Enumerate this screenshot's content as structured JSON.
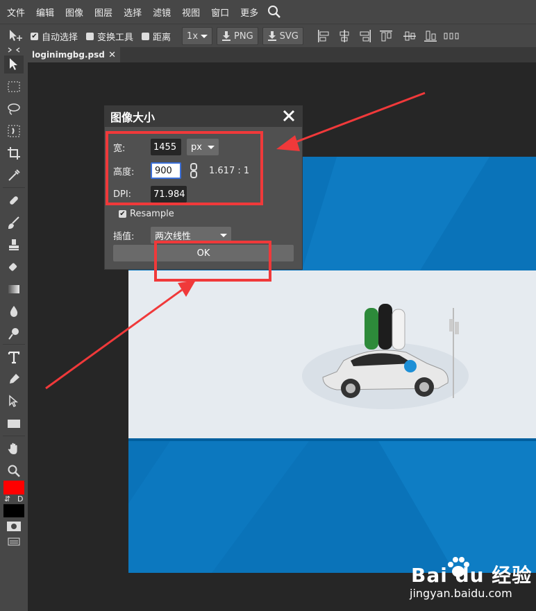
{
  "menu": {
    "items": [
      "文件",
      "编辑",
      "图像",
      "图层",
      "选择",
      "滤镜",
      "视图",
      "窗口",
      "更多"
    ],
    "search_icon": "search-icon"
  },
  "options": {
    "auto_select": "自动选择",
    "transform_tools": "变换工具",
    "distance": "距离",
    "zoom": "1x",
    "png": "PNG",
    "svg": "SVG"
  },
  "document": {
    "tab_name": "loginimgbg.psd",
    "close": "✕"
  },
  "dialog": {
    "title": "图像大小",
    "width_label": "宽:",
    "width_value": "1455",
    "unit": "px",
    "height_label": "高度:",
    "height_value": "900",
    "ratio": "1.617 : 1",
    "dpi_label": "DPI:",
    "dpi_value": "71.984",
    "resample_label": "Resample",
    "interp_label": "插值:",
    "interp_value": "两次线性",
    "ok_label": "OK"
  },
  "colors": {
    "foreground": "#ff0000",
    "background": "#000000",
    "highlight": "#f0393a",
    "canvas_blue": "#0a73b9"
  },
  "swatches": {
    "swap": "⇵",
    "default": "D"
  },
  "watermark": {
    "brand": "Bai du 经验",
    "url": "jingyan.baidu.com"
  }
}
